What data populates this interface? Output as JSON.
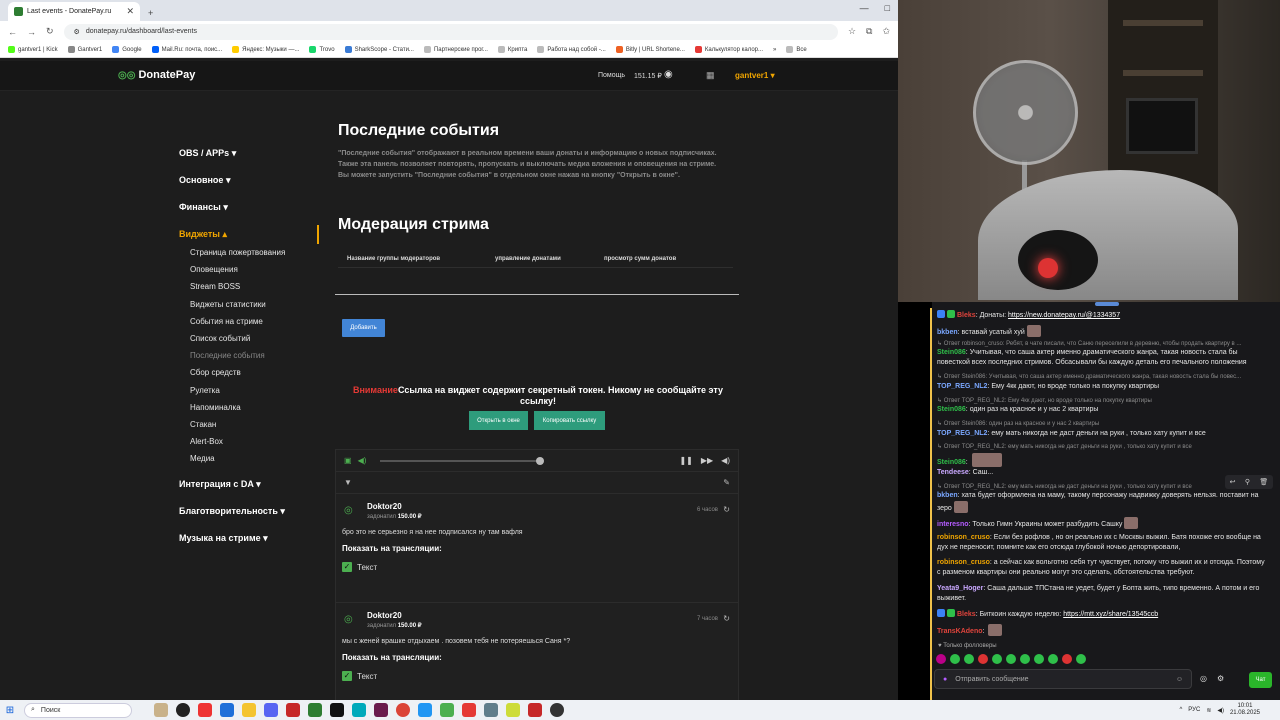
{
  "browser": {
    "tab_title": "Last events - DonatePay.ru",
    "url": "donatepay.ru/dashboard/last-events",
    "bookmarks": [
      "gantver1 | Kick",
      "Gantver1",
      "Google",
      "Mail.Ru: почта, поис...",
      "Яндекс: Музыки —...",
      "Trovo",
      "SharkScope - Стати...",
      "Партнерские прог...",
      "Крипта",
      "Работа над собой -...",
      "Bitly | URL Shortene...",
      "Калькулятор калор..."
    ],
    "bookmarks_more": "Все"
  },
  "header": {
    "logo": "DonatePay",
    "help": "Помощь",
    "balance": "151.15 ₽",
    "user": "gantver1"
  },
  "sidebar": {
    "sections": [
      "OBS / APPs",
      "Основное",
      "Финансы"
    ],
    "widgets_label": "Виджеты",
    "widget_items": [
      "Страница пожертвования",
      "Оповещения",
      "Stream BOSS",
      "Виджеты статистики",
      "События на стриме",
      "Список событий",
      "Последние события",
      "Сбор средств",
      "Рулетка",
      "Напоминалка",
      "Стакан",
      "Alert-Box",
      "Медиа"
    ],
    "bottom": [
      "Интеграция с DA",
      "Благотворительность",
      "Музыка на стриме"
    ]
  },
  "content": {
    "title": "Последние события",
    "desc1": "\"Последние события\" отображают в реальном времени ваши донаты и информацию о новых подписчиках.",
    "desc2": "Также эта панель позволяет повторять, пропускать и выключать медиа вложения и оповещения на стриме.",
    "desc3": "Вы можете запустить \"Последние события\" в отдельном окне нажав на кнопку \"Открыть в окне\".",
    "moderation_title": "Модерация стрима",
    "col1": "Название группы модераторов",
    "col2": "управление донатами",
    "col3": "просмотр сумм донатов",
    "add_button": "Добавить",
    "warn_red": "Внимание",
    "warn_text": "Ссылка на виджет содержит секретный токен. Никому не сообщайте эту ссылку!",
    "open_window": "Открыть в окне",
    "copy_link": "Копировать ссылку"
  },
  "events": [
    {
      "name": "Doktor20",
      "donated": "задонатил",
      "amount": "150.00 ₽",
      "time": "6 часов",
      "message": "бро это не серьезно я на нее подписался ну там вафля",
      "show_label": "Показать на трансляции:",
      "check_label": "Текст"
    },
    {
      "name": "Doktor20",
      "donated": "задонатил",
      "amount": "150.00 ₽",
      "time": "7 часов",
      "message": "мы с женей врашке отдыхаем . позовем тебя не потеряешься Саня *?",
      "show_label": "Показать на трансляции:",
      "check_label": "Текст"
    }
  ],
  "chat": {
    "messages": [
      {
        "user": "Bleks",
        "text": "Донаты: ",
        "link": "https://new.donatepay.ru/@1334357",
        "color": "#e0443c"
      },
      {
        "user": "bkben",
        "text": "вставай усатый хуй",
        "color": "#7aa7ff"
      },
      {
        "reply": "Ответ robinson_cruso: Ребят, в чате писали, что Саню переселили в деревню, чтобы продать квартиру в ..."
      },
      {
        "user": "Stein086",
        "text": "Учитывая, что саша актер именно драматического жанра, такая новость стала бы повесткой всех последних стримов. Обсасывали бы каждую деталь его печального положения",
        "color": "#2fbf4a"
      },
      {
        "reply": "Ответ Stein086: Учитывая, что саша актер именно драматического жанра, такая новость стала бы повес..."
      },
      {
        "user": "TOP_REG_NL2",
        "text": "Ему 4кк дают, но вроде только на покупку квартиры",
        "color": "#7aa7ff"
      },
      {
        "reply": "Ответ TOP_REG_NL2: Ему 4кк дают, но вроде только на покупку квартиры"
      },
      {
        "user": "Stein086",
        "text": "один раз на красное и у нас 2 квартиры",
        "color": "#2fbf4a"
      },
      {
        "reply": "Ответ Stein086: один раз на красное и у нас 2 квартиры"
      },
      {
        "user": "TOP_REG_NL2",
        "text": "ему мать никогда не даст деньги на руки , только хату купит и все",
        "color": "#7aa7ff"
      },
      {
        "reply": "Ответ TOP_REG_NL2: ему мать никогда не даст деньги на руки , только хату купит и все"
      },
      {
        "user": "Stein086",
        "text": "",
        "color": "#2fbf4a"
      },
      {
        "user": "Tendeese",
        "text": "Саш...",
        "color": "#c9a8ff"
      },
      {
        "reply": "Ответ TOP_REG_NL2: ему мать никогда не даст деньги на руки , только хату купит и все"
      },
      {
        "user": "bkben",
        "text": "хата будет оформлена на маму, такому персонажу надвижку доверять нельзя. поставит на зеро",
        "color": "#7aa7ff"
      },
      {
        "user": "interesno",
        "text": "Только Гимн Украины может разбудить Сашку",
        "color": "#b45cff"
      },
      {
        "user": "robinson_cruso",
        "text": "Если без рофлов , но он реально их с Москвы выжил. Батя похоже его вообще на дух не переносит, помните как его отсюда глубокой ночью депортировали,",
        "color": "#f0a500"
      },
      {
        "user": "robinson_cruso",
        "text": "а сейчас как вольготно себя тут чувствует, потому что выжил их и отсюда. Поэтому с разменом квартиры они реально могут это сделать, обстоятельства требуют.",
        "color": "#f0a500"
      },
      {
        "user": "Yeata9_Hoger",
        "text": "Саша дальше ТПСтана не уедет, будет у Бопта жить, типо временно. А потом и его выживет.",
        "color": "#c9a8ff"
      },
      {
        "user": "Bleks",
        "text": "Биткоин каждую неделю: ",
        "link": "https://mtt.xyz/share/13545ccb",
        "color": "#e0443c"
      },
      {
        "user": "TransKAdeno",
        "text": "",
        "color": "#e0443c"
      }
    ],
    "followers_label": "Только фолловеры",
    "input_placeholder": "Отправить сообщение",
    "send": "Чат"
  },
  "taskbar": {
    "search": "Поиск",
    "lang": "РУС",
    "time": "10:01",
    "date": "21.08.2025"
  }
}
